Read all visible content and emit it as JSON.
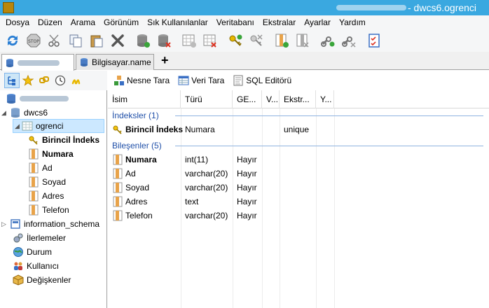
{
  "window": {
    "title": "- dwcs6.ogrenci"
  },
  "menu": [
    "Dosya",
    "Düzen",
    "Arama",
    "Görünüm",
    "Sık Kullanılanlar",
    "Veritabanı",
    "Ekstralar",
    "Ayarlar",
    "Yardım"
  ],
  "tabs": [
    {
      "label": "",
      "active": true
    },
    {
      "label": "Bilgisayar.name",
      "active": false
    }
  ],
  "right_toolbar": {
    "object_view": "Nesne Tara",
    "data_view": "Veri Tara",
    "sql_editor": "SQL Editörü"
  },
  "tree": {
    "database": "dwcs6",
    "table": "ogrenci",
    "children": [
      "Birincil İndeks",
      "Numara",
      "Ad",
      "Soyad",
      "Adres",
      "Telefon"
    ],
    "other_db": "information_schema",
    "items": [
      "İlerlemeler",
      "Durum",
      "Kullanıcı",
      "Değişkenler"
    ]
  },
  "grid": {
    "headers": [
      "İsim",
      "Türü",
      "GE...",
      "V...",
      "Ekstr...",
      "Y..."
    ],
    "indexes_group": "İndeksler (1)",
    "indexes": [
      {
        "name": "Birincil İndeks",
        "type": "Numara",
        "extra": "unique"
      }
    ],
    "columns_group": "Bileşenler (5)",
    "columns": [
      {
        "name": "Numara",
        "type": "int(11)",
        "nullable": "Hayır",
        "bold": true
      },
      {
        "name": "Ad",
        "type": "varchar(20)",
        "nullable": "Hayır",
        "bold": false
      },
      {
        "name": "Soyad",
        "type": "varchar(20)",
        "nullable": "Hayır",
        "bold": false
      },
      {
        "name": "Adres",
        "type": "text",
        "nullable": "Hayır",
        "bold": false
      },
      {
        "name": "Telefon",
        "type": "varchar(20)",
        "nullable": "Hayır",
        "bold": false
      }
    ]
  },
  "colors": {
    "titlebar": "#3aa8e0",
    "group_text": "#1f4fa8",
    "selection": "#cce8ff"
  }
}
